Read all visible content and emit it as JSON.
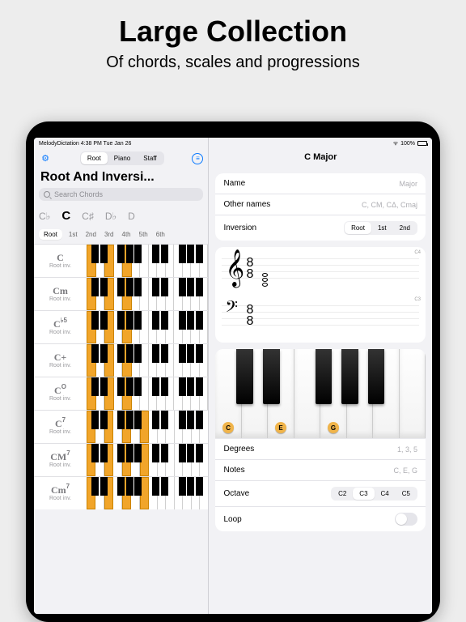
{
  "promo": {
    "title": "Large Collection",
    "subtitle": "Of chords, scales and progressions"
  },
  "status": {
    "left": "MelodyDictation   4:38 PM   Tue Jan 26",
    "battery": "100%"
  },
  "left": {
    "seg": [
      "Root",
      "Piano",
      "Staff"
    ],
    "seg_active": 0,
    "title": "Root And Inversi...",
    "search_placeholder": "Search Chords",
    "roots": [
      "C♭",
      "C",
      "C♯",
      "D♭",
      "D"
    ],
    "roots_active": 1,
    "inversions": [
      "Root",
      "1st",
      "2nd",
      "3rd",
      "4th",
      "5th",
      "6th"
    ],
    "inv_active": 0,
    "chords": [
      {
        "name": "C",
        "sup": "",
        "sub": "Root inv."
      },
      {
        "name": "Cm",
        "sup": "",
        "sub": "Root inv."
      },
      {
        "name": "C",
        "sup": "♭5",
        "sub": "Root inv."
      },
      {
        "name": "C+",
        "sup": "",
        "sub": "Root inv."
      },
      {
        "name": "C",
        "sup": "O",
        "sub": "Root inv."
      },
      {
        "name": "C",
        "sup": "7",
        "sub": "Root inv."
      },
      {
        "name": "CM",
        "sup": "7",
        "sub": "Root inv."
      },
      {
        "name": "Cm",
        "sup": "7",
        "sub": "Root inv."
      }
    ]
  },
  "right": {
    "header": "C Major",
    "name_label": "Name",
    "name_value": "Major",
    "other_label": "Other names",
    "other_value": "C, CM, CΔ, Cmaj",
    "inversion_label": "Inversion",
    "inversion_opts": [
      "Root",
      "1st",
      "2nd"
    ],
    "inversion_active": 0,
    "staff_c4": "C4",
    "staff_c3": "C3",
    "degrees_label": "Degrees",
    "degrees_value": "1, 3, 5",
    "notes_label": "Notes",
    "notes_value": "C, E, G",
    "octave_label": "Octave",
    "octave_opts": [
      "C2",
      "C3",
      "C4",
      "C5"
    ],
    "octave_active": 1,
    "loop_label": "Loop",
    "keys": [
      "C",
      "E",
      "G"
    ]
  }
}
